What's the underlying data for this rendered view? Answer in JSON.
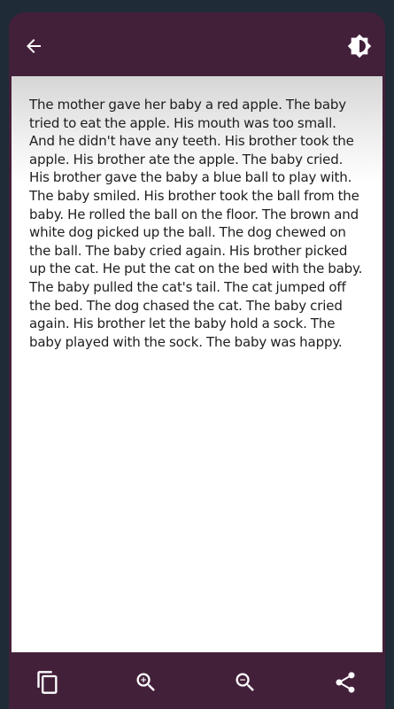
{
  "app_bar": {
    "back_icon": "arrow-left-icon",
    "theme_icon": "brightness-contrast-icon"
  },
  "content": {
    "story_text": "The mother gave her baby a red apple. The baby tried to eat the apple. His mouth was too small. And he didn't have any teeth. His brother took the apple. His brother ate the apple. The baby cried. His brother gave the baby a blue ball to play with. The baby smiled. His brother took the ball from the baby. He rolled the ball on the floor. The brown and white dog picked up the ball. The dog chewed on the ball. The baby cried again. His brother picked up the cat. He put the cat on the bed with the baby. The baby pulled the cat's tail. The cat jumped off the bed. The dog chased the cat. The baby cried again. His brother let the baby hold a sock. The baby played with the sock. The baby was happy."
  },
  "bottom_bar": {
    "icons": [
      "copy-icon",
      "zoom-in-icon",
      "zoom-out-icon",
      "share-icon"
    ]
  },
  "colors": {
    "bar_background": "#43203a",
    "outer_background": "#1f2b37",
    "page_background": "#ffffff",
    "text": "#1e1e1e",
    "icon": "#ffffff"
  }
}
